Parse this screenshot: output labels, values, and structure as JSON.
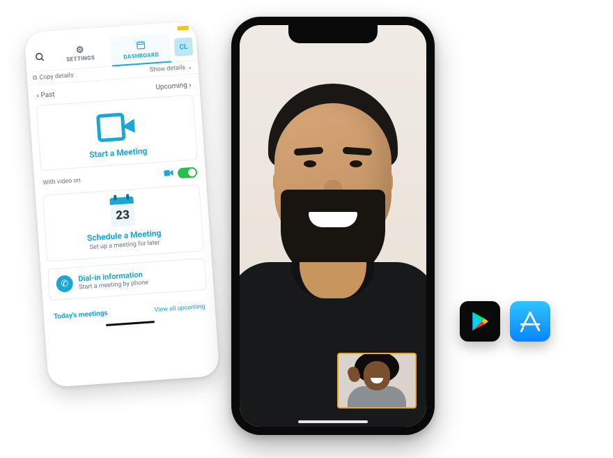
{
  "dashboard": {
    "tabs": {
      "settings": "SETTINGS",
      "dashboard": "DASHBOARD"
    },
    "avatar_initials": "CL",
    "subbar": {
      "copy": "Copy details",
      "show": "Show details"
    },
    "nav": {
      "past": "Past",
      "upcoming": "Upcoming"
    },
    "start_card": {
      "title": "Start a Meeting",
      "with_video_label": "With video on"
    },
    "schedule_card": {
      "day": "23",
      "title": "Schedule a Meeting",
      "subtitle": "Set up a meeting for later"
    },
    "dialin_card": {
      "title": "Dial-in information",
      "subtitle": "Start a meeting by phone"
    },
    "footer": {
      "today": "Today's meetings",
      "view_all": "View all upcoming"
    }
  },
  "stores": {
    "play": "Google Play",
    "appstore": "App Store"
  }
}
